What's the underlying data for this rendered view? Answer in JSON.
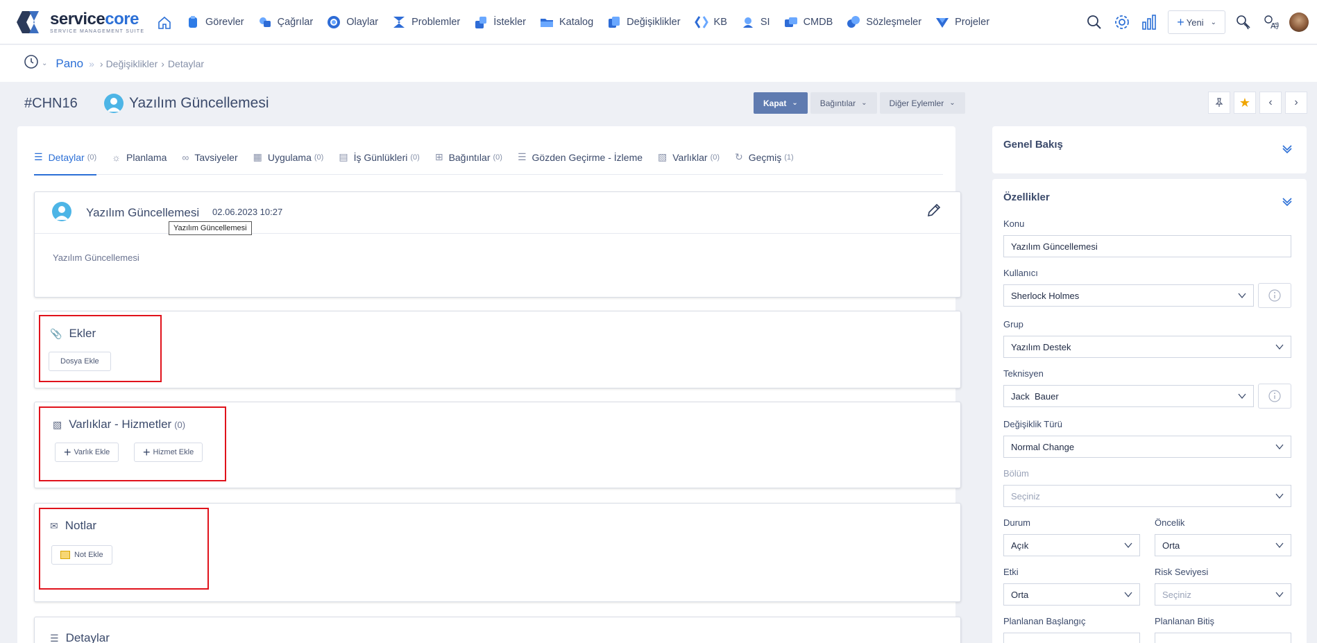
{
  "app": {
    "logo_name_a": "service",
    "logo_name_b": "core",
    "logo_sub": "SERVICE MANAGEMENT SUITE"
  },
  "nav": [
    {
      "label": "Görevler",
      "icon": "tasks-icon"
    },
    {
      "label": "Çağrılar",
      "icon": "calls-icon"
    },
    {
      "label": "Olaylar",
      "icon": "incidents-icon"
    },
    {
      "label": "Problemler",
      "icon": "problems-icon"
    },
    {
      "label": "İstekler",
      "icon": "requests-icon"
    },
    {
      "label": "Katalog",
      "icon": "catalog-icon"
    },
    {
      "label": "Değişiklikler",
      "icon": "changes-icon"
    },
    {
      "label": "KB",
      "icon": "kb-icon"
    },
    {
      "label": "SI",
      "icon": "si-icon"
    },
    {
      "label": "CMDB",
      "icon": "cmdb-icon"
    },
    {
      "label": "Sözleşmeler",
      "icon": "contracts-icon"
    },
    {
      "label": "Projeler",
      "icon": "projects-icon"
    }
  ],
  "toolbar": {
    "new_label": "Yeni"
  },
  "breadcrumb": {
    "home": "Pano",
    "items": [
      "Değişiklikler",
      "Detaylar"
    ]
  },
  "ticket": {
    "id": "#CHN16",
    "title": "Yazılım Güncellemesi"
  },
  "actions": {
    "close": "Kapat",
    "relations": "Bağıntılar",
    "other": "Diğer Eylemler"
  },
  "tabs": [
    {
      "label": "Detaylar",
      "count": "(0)"
    },
    {
      "label": "Planlama",
      "count": ""
    },
    {
      "label": "Tavsiyeler",
      "count": ""
    },
    {
      "label": "Uygulama",
      "count": "(0)"
    },
    {
      "label": "İş Günlükleri",
      "count": "(0)"
    },
    {
      "label": "Bağıntılar",
      "count": "(0)"
    },
    {
      "label": "Gözden Geçirme - İzleme",
      "count": ""
    },
    {
      "label": "Varlıklar",
      "count": "(0)"
    },
    {
      "label": "Geçmiş",
      "count": "(1)"
    }
  ],
  "description": {
    "title": "Yazılım Güncellemesi",
    "date": "02.06.2023 10:27",
    "tooltip": "Yazılım Güncellemesi",
    "body": "Yazılım Güncellemesi"
  },
  "attachments": {
    "title": "Ekler",
    "add_file": "Dosya Ekle"
  },
  "assets": {
    "title": "Varlıklar - Hizmetler",
    "count": "(0)",
    "add_asset": "Varlık Ekle",
    "add_service": "Hizmet Ekle"
  },
  "notes": {
    "title": "Notlar",
    "add_note": "Not Ekle"
  },
  "details_section": {
    "title": "Detaylar"
  },
  "sidebar": {
    "overview_title": "Genel Bakış",
    "props_title": "Özellikler",
    "fields": {
      "konu": {
        "label": "Konu",
        "value": "Yazılım Güncellemesi"
      },
      "kullanici": {
        "label": "Kullanıcı",
        "value": "Sherlock Holmes"
      },
      "grup": {
        "label": "Grup",
        "value": "Yazılım Destek"
      },
      "teknisyen": {
        "label": "Teknisyen",
        "value": "Jack  Bauer"
      },
      "degisiklik_turu": {
        "label": "Değişiklik Türü",
        "value": "Normal Change"
      },
      "bolum": {
        "label": "Bölüm",
        "value": "Seçiniz"
      },
      "durum": {
        "label": "Durum",
        "value": "Açık"
      },
      "oncelik": {
        "label": "Öncelik",
        "value": "Orta"
      },
      "etki": {
        "label": "Etki",
        "value": "Orta"
      },
      "risk": {
        "label": "Risk Seviyesi",
        "value": "Seçiniz"
      },
      "plan_baslangic": {
        "label": "Planlanan Başlangıç"
      },
      "plan_bitis": {
        "label": "Planlanan Bitiş"
      }
    }
  }
}
